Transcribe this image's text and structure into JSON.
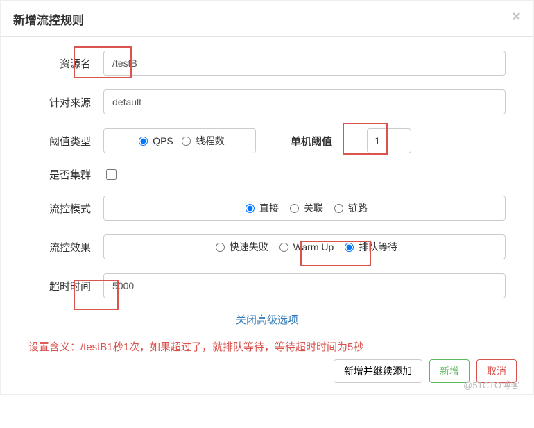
{
  "header": {
    "title": "新增流控规则"
  },
  "form": {
    "resourceName": {
      "label": "资源名",
      "value": "/testB"
    },
    "source": {
      "label": "针对来源",
      "value": "default"
    },
    "thresholdType": {
      "label": "阈值类型",
      "options": [
        {
          "label": "QPS",
          "checked": true
        },
        {
          "label": "线程数",
          "checked": false
        }
      ],
      "singleLabel": "单机阈值",
      "singleValue": "1"
    },
    "isCluster": {
      "label": "是否集群",
      "checked": false
    },
    "flowMode": {
      "label": "流控模式",
      "options": [
        {
          "label": "直接",
          "checked": true
        },
        {
          "label": "关联",
          "checked": false
        },
        {
          "label": "链路",
          "checked": false
        }
      ]
    },
    "flowEffect": {
      "label": "流控效果",
      "options": [
        {
          "label": "快速失败",
          "checked": false
        },
        {
          "label": "Warm Up",
          "checked": false
        },
        {
          "label": "排队等待",
          "checked": true
        }
      ]
    },
    "timeout": {
      "label": "超时时间",
      "value": "5000"
    }
  },
  "adv": {
    "close": "关闭高级选项"
  },
  "note": "设置含义：/testB1秒1次，如果超过了，就排队等待，等待超时时间为5秒",
  "footer": {
    "addContinue": "新增并继续添加",
    "add": "新增",
    "cancel": "取消"
  },
  "watermark": "@51CTO博客"
}
